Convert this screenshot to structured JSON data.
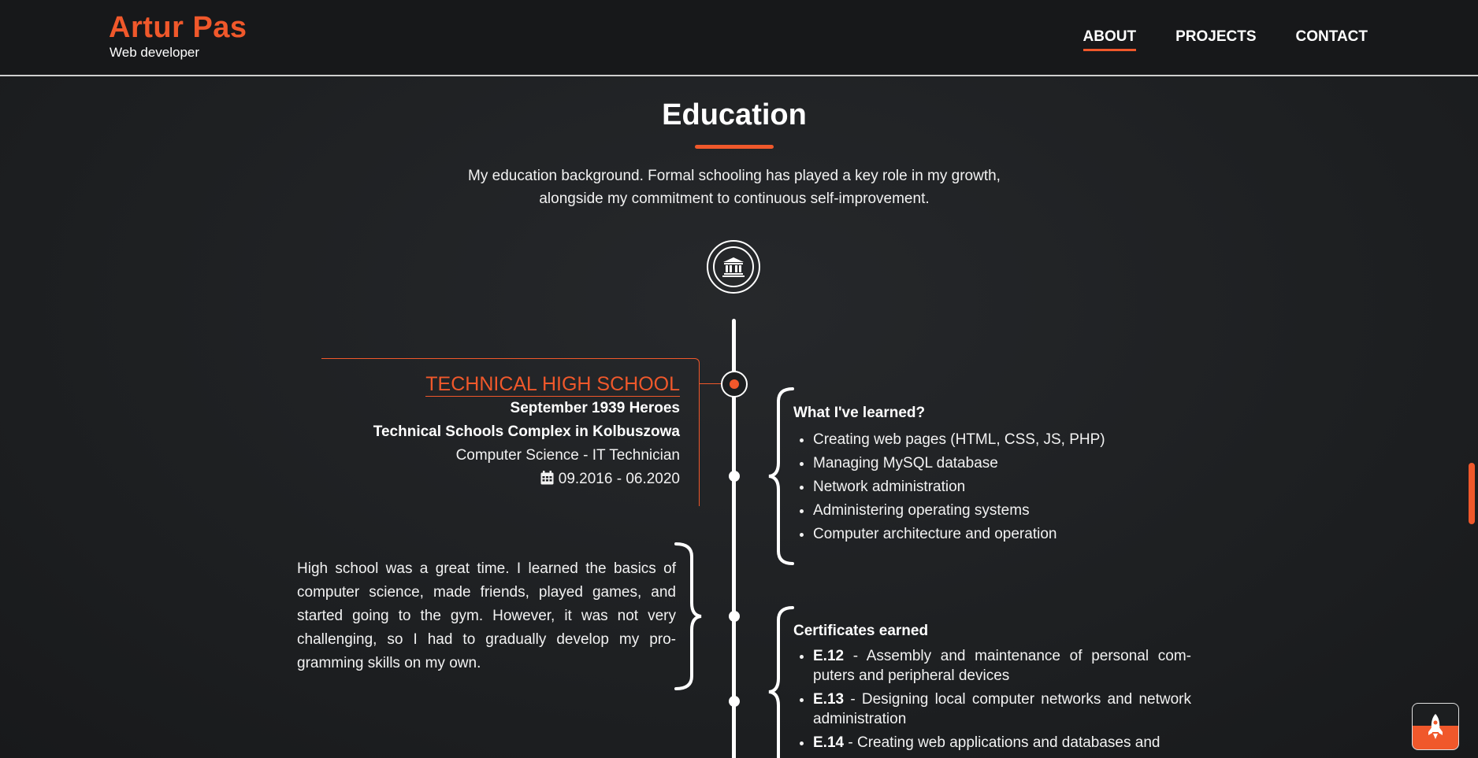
{
  "header": {
    "name": "Artur Pas",
    "subtitle": "Web developer",
    "nav": [
      {
        "label": "ABOUT",
        "active": true
      },
      {
        "label": "PROJECTS",
        "active": false
      },
      {
        "label": "CONTACT",
        "active": false
      }
    ]
  },
  "section": {
    "title": "Education",
    "intro_line1": "My education background. Formal schooling has played a key role in my growth,",
    "intro_line2": "alongside my commitment to continuous self-improvement."
  },
  "school": {
    "title": "TECHNICAL HIGH SCHOOL",
    "line1": "September 1939 Heroes",
    "line2": "Technical Schools Complex in Kolbuszowa",
    "field": "Computer Science - IT Technician",
    "dates": "09.2016 - 06.2020"
  },
  "story": "High school was a great time. I learned the basics of computer science, made friends, played games, and started going to the gym. However, it was not very challenging, so I had to gradually develop my pro­gramming skills on my own.",
  "learned": {
    "title": "What I've learned?",
    "items": [
      "Creating web pages (HTML, CSS, JS, PHP)",
      "Managing MySQL database",
      "Network administration",
      "Administering operating systems",
      "Computer architecture and operation"
    ]
  },
  "certificates": {
    "title": "Certificates earned",
    "items": [
      {
        "code": "E.12",
        "text": " - Assembly and maintenance of personal com­puters and peripheral devices"
      },
      {
        "code": "E.13",
        "text": " - Designing local computer networks and net­work administration"
      },
      {
        "code": "E.14",
        "text": " - Creating web applications and databases and"
      }
    ]
  },
  "colors": {
    "accent": "#f0582b",
    "background": "#1d1f21",
    "text": "#ffffff"
  },
  "icons": {
    "timeline_top": "institution-icon",
    "date": "calendar-icon",
    "back_to_top": "rocket-icon"
  }
}
